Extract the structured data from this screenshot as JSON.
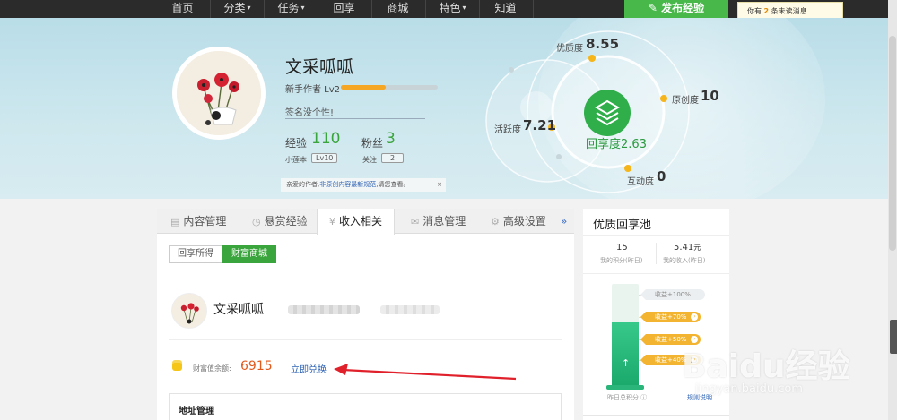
{
  "nav": {
    "items": [
      {
        "label": "首页",
        "caret": ""
      },
      {
        "label": "分类",
        "caret": "▾"
      },
      {
        "label": "任务",
        "caret": "▾"
      },
      {
        "label": "回享",
        "caret": ""
      },
      {
        "label": "商城",
        "caret": ""
      },
      {
        "label": "特色",
        "caret": "▾"
      },
      {
        "label": "知道",
        "caret": ""
      }
    ],
    "publish_label": "发布经验",
    "publish_icon": "pencil-icon"
  },
  "message_tip": {
    "prefix": "你有",
    "count": "2",
    "suffix": "条未读消息"
  },
  "profile": {
    "name": "文采呱呱",
    "level_text": "新手作者 Lv2",
    "level_progress": 0.46,
    "signature": "签名没个性!",
    "exp_label": "经验",
    "exp_value": "110",
    "fans_label": "粉丝",
    "fans_value": "3",
    "rank_label": "小莲本",
    "rank_badge": "Lv10",
    "follow_label": "关注",
    "follow_value": "2",
    "notice_prefix": "亲爱的作者,",
    "notice_link": "非原创内容最新规范,",
    "notice_suffix": "请您查看。",
    "notice_close": "×"
  },
  "scores": {
    "center_label": "回享度",
    "center_value": "2.63",
    "quality_label": "优质度",
    "quality_value": "8.55",
    "original_label": "原创度",
    "original_value": "10",
    "activity_label": "活跃度",
    "activity_value": "7.21",
    "interaction_label": "互动度",
    "interaction_value": "0"
  },
  "tabs": [
    {
      "label": "内容管理",
      "icon": "document-icon"
    },
    {
      "label": "悬赏经验",
      "icon": "clock-icon"
    },
    {
      "label": "收入相关",
      "icon": "money-icon"
    },
    {
      "label": "消息管理",
      "icon": "mail-icon"
    },
    {
      "label": "高级设置",
      "icon": "gear-icon"
    }
  ],
  "tab_more": "»",
  "subtabs": [
    "回享所得",
    "财富商城"
  ],
  "wallet": {
    "name": "文采呱呱",
    "balance_label": "财富值余额:",
    "balance_value": "6915",
    "redeem_label": "立即兑换"
  },
  "address": {
    "title": "地址管理"
  },
  "pool": {
    "title": "优质回享池",
    "points_value": "15",
    "points_label": "我的积分(昨日)",
    "income_value": "5.41",
    "income_unit": "元",
    "income_label": "我的收入(昨日)",
    "level_fill": 0.63,
    "tags": [
      {
        "label": "收益+100%",
        "chev": ""
      },
      {
        "label": "收益+70%",
        "chev": "›"
      },
      {
        "label": "收益+50%",
        "chev": "›"
      },
      {
        "label": "收益+40%",
        "chev": "›"
      }
    ],
    "footer_left": "昨日总积分 ⓘ",
    "footer_right": "规则说明"
  },
  "watermark": {
    "main": "Baidu经验",
    "sub": "jingyan.baidu.com"
  },
  "colors": {
    "accent_green": "#3aa53c",
    "orange": "#f5a623",
    "balance_red": "#e25a1c",
    "link_blue": "#2f64b5"
  }
}
